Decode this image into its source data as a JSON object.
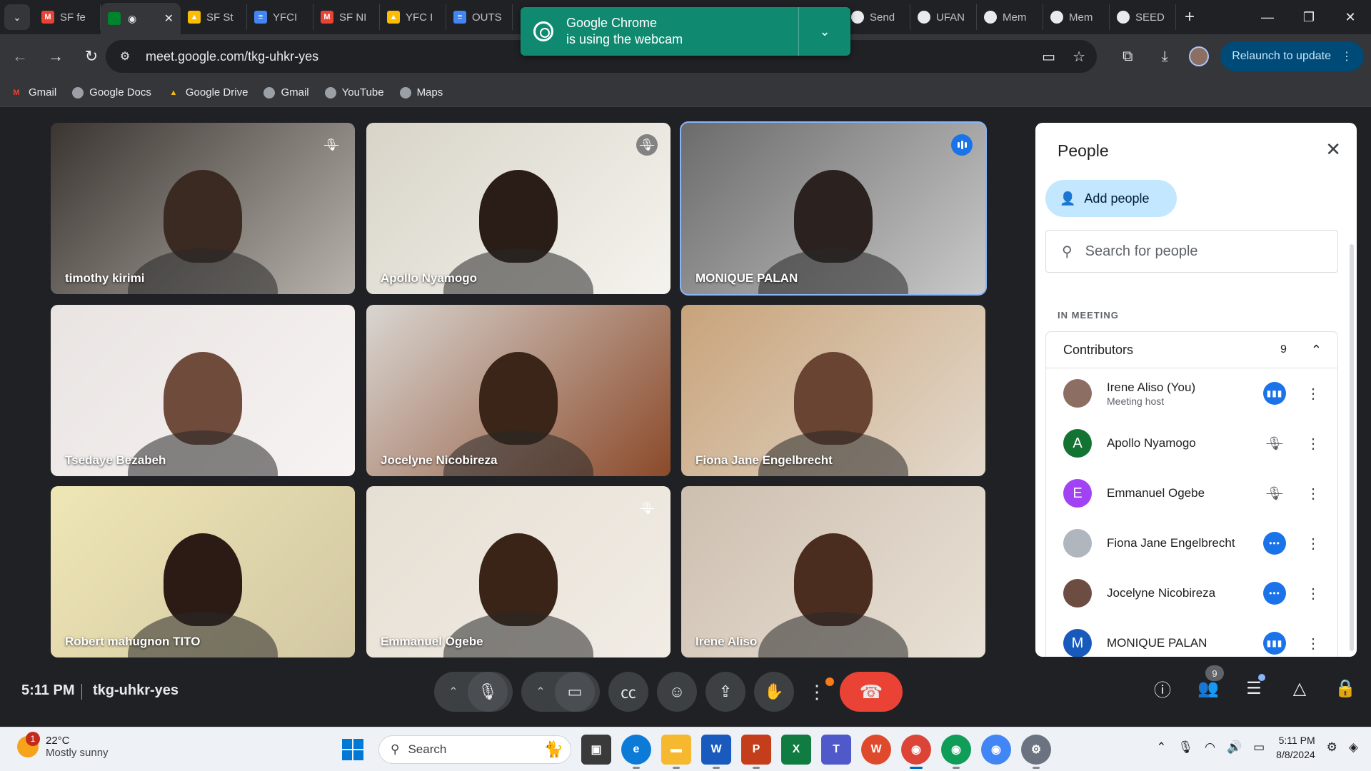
{
  "browser": {
    "tabs": [
      {
        "label": "SF fe",
        "icon": "gmail-icon",
        "color": "#ea4335",
        "glyph": "M"
      },
      {
        "label": "",
        "icon": "meet-icon",
        "color": "#00832d",
        "glyph": "",
        "active": true
      },
      {
        "label": "SF St",
        "icon": "drive-icon",
        "color": "#fbbc04",
        "glyph": "▲"
      },
      {
        "label": "YFCI",
        "icon": "docs-icon",
        "color": "#4285f4",
        "glyph": "≡"
      },
      {
        "label": "SF NI",
        "icon": "gmail-icon",
        "color": "#ea4335",
        "glyph": "M"
      },
      {
        "label": "YFC I",
        "icon": "drive-icon",
        "color": "#fbbc04",
        "glyph": "▲"
      },
      {
        "label": "OUTS",
        "icon": "docs-icon",
        "color": "#4285f4",
        "glyph": "≡"
      }
    ],
    "tabs_right": [
      {
        "label": "Send",
        "icon": "chrome-icon"
      },
      {
        "label": "UFAN",
        "icon": "chrome-icon"
      },
      {
        "label": "Mem",
        "icon": "chrome-icon"
      },
      {
        "label": "Mem",
        "icon": "chrome-icon"
      },
      {
        "label": "SEED",
        "icon": "google-icon"
      }
    ],
    "url": "meet.google.com/tkg-uhkr-yes",
    "relaunch_label": "Relaunch to update",
    "bookmarks": [
      {
        "label": "Gmail",
        "icon": "gmail-icon"
      },
      {
        "label": "Google Docs",
        "icon": "globe-icon"
      },
      {
        "label": "Google Drive",
        "icon": "drive-icon"
      },
      {
        "label": "Gmail",
        "icon": "globe-icon"
      },
      {
        "label": "YouTube",
        "icon": "globe-icon"
      },
      {
        "label": "Maps",
        "icon": "globe-icon"
      }
    ]
  },
  "notification": {
    "line1": "Google Chrome",
    "line2": "is using the webcam"
  },
  "meeting": {
    "tiles": [
      {
        "name": "timothy kirimi",
        "muted": true,
        "speaking": false,
        "bg": [
          "#3a3530",
          "#b8b3ad"
        ],
        "skin": "#3b2a22"
      },
      {
        "name": "Apollo Nyamogo",
        "muted": true,
        "speaking": false,
        "bg": [
          "#d8d4c8",
          "#f5f3ee"
        ],
        "skin": "#2a1d17"
      },
      {
        "name": "MONIQUE PALAN",
        "muted": false,
        "speaking": true,
        "bg": [
          "#6b6b6b",
          "#c9c9c9"
        ],
        "skin": "#2b2220"
      },
      {
        "name": "Tsedaye Bezabeh",
        "muted": false,
        "speaking": false,
        "bg": [
          "#e9e4e2",
          "#f7f3f2"
        ],
        "skin": "#6f4b3c"
      },
      {
        "name": "Jocelyne Nicobireza",
        "muted": false,
        "speaking": false,
        "bg": [
          "#d9d6d2",
          "#8b4a2a"
        ],
        "skin": "#3b2518"
      },
      {
        "name": "Fiona Jane Engelbrecht",
        "muted": false,
        "speaking": false,
        "bg": [
          "#c8a37a",
          "#e3d9cc"
        ],
        "skin": "#6a4432"
      },
      {
        "name": "Robert mahugnon TITO",
        "muted": false,
        "speaking": false,
        "bg": [
          "#efe6b5",
          "#d2c7a3"
        ],
        "skin": "#2b1b14"
      },
      {
        "name": "Emmanuel Ogebe",
        "muted": true,
        "speaking": false,
        "bg": [
          "#e6dfd3",
          "#f1ece5"
        ],
        "skin": "#3a2418"
      },
      {
        "name": "Irene Aliso",
        "muted": false,
        "speaking": false,
        "bg": [
          "#cdbfb0",
          "#e9e1d5"
        ],
        "skin": "#4a2d1f"
      }
    ],
    "clock": "5:11 PM",
    "code": "tkg-uhkr-yes",
    "participants_badge": "9"
  },
  "people_panel": {
    "title": "People",
    "add_label": "Add people",
    "search_placeholder": "Search for people",
    "section": "IN MEETING",
    "group": "Contributors",
    "group_count": "9",
    "people": [
      {
        "name": "Irene Aliso (You)",
        "sub": "Meeting host",
        "avatar": "",
        "avatar_color": "#8d6e63",
        "status": "speaking"
      },
      {
        "name": "Apollo Nyamogo",
        "sub": "",
        "avatar": "A",
        "avatar_color": "#137333",
        "status": "muted"
      },
      {
        "name": "Emmanuel Ogebe",
        "sub": "",
        "avatar": "E",
        "avatar_color": "#a142f4",
        "status": "muted"
      },
      {
        "name": "Fiona Jane Engelbrecht",
        "sub": "",
        "avatar": "",
        "avatar_color": "#b0b6bd",
        "status": "active"
      },
      {
        "name": "Jocelyne Nicobireza",
        "sub": "",
        "avatar": "",
        "avatar_color": "#6d4c41",
        "status": "active"
      },
      {
        "name": "MONIQUE PALAN",
        "sub": "",
        "avatar": "M",
        "avatar_color": "#185abc",
        "status": "speaking"
      }
    ]
  },
  "taskbar": {
    "temperature": "22°C",
    "weather": "Mostly sunny",
    "weather_alert": "1",
    "search_label": "Search",
    "time": "5:11 PM",
    "date": "8/8/2024"
  }
}
